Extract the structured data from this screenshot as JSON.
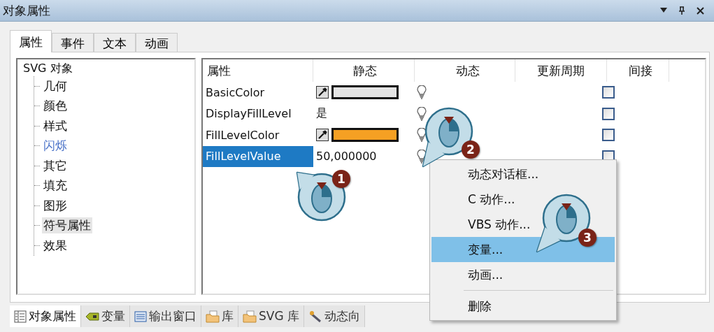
{
  "window": {
    "title": "对象属性"
  },
  "tabs": [
    {
      "label": "属性",
      "selected": true
    },
    {
      "label": "事件",
      "selected": false
    },
    {
      "label": "文本",
      "selected": false
    },
    {
      "label": "动画",
      "selected": false
    }
  ],
  "tree": {
    "label": "SVG 对象",
    "children": [
      {
        "label": "几何",
        "selected": false,
        "dynamic": false
      },
      {
        "label": "颜色",
        "selected": false,
        "dynamic": false
      },
      {
        "label": "样式",
        "selected": false,
        "dynamic": false
      },
      {
        "label": "闪烁",
        "selected": false,
        "dynamic": true
      },
      {
        "label": "其它",
        "selected": false,
        "dynamic": false
      },
      {
        "label": "填充",
        "selected": false,
        "dynamic": false
      },
      {
        "label": "图形",
        "selected": false,
        "dynamic": false
      },
      {
        "label": "符号属性",
        "selected": true,
        "dynamic": false
      },
      {
        "label": "效果",
        "selected": false,
        "dynamic": false
      }
    ]
  },
  "table": {
    "columns": [
      "属性",
      "静态",
      "动态",
      "更新周期",
      "间接"
    ],
    "rows": [
      {
        "name": "BasicColor",
        "kind": "color",
        "color": "#e4e4e4",
        "selected": false,
        "indirect": false
      },
      {
        "name": "DisplayFillLevel",
        "kind": "text",
        "value": "是",
        "selected": false,
        "indirect": false
      },
      {
        "name": "FillLevelColor",
        "kind": "color",
        "color": "#f5a023",
        "selected": false,
        "indirect": false
      },
      {
        "name": "FillLevelValue",
        "kind": "text",
        "value": "50,000000",
        "selected": true,
        "indirect": false
      }
    ]
  },
  "context_menu": [
    {
      "kind": "item",
      "label": "动态对话框...",
      "selected": false
    },
    {
      "kind": "item",
      "label": "C 动作...",
      "selected": false
    },
    {
      "kind": "item",
      "label": "VBS 动作...",
      "selected": false
    },
    {
      "kind": "item",
      "label": "变量...",
      "selected": true
    },
    {
      "kind": "item",
      "label": "动画...",
      "selected": false
    },
    {
      "kind": "separator"
    },
    {
      "kind": "item",
      "label": "删除",
      "selected": false
    }
  ],
  "callouts": [
    "1",
    "2",
    "3"
  ],
  "bottom_tabs": [
    {
      "label": "对象属性",
      "selected": true
    },
    {
      "label": "变量",
      "selected": false
    },
    {
      "label": "输出窗口",
      "selected": false
    },
    {
      "label": "库",
      "selected": false
    },
    {
      "label": "SVG 库",
      "selected": false
    },
    {
      "label": "动态向",
      "selected": false
    }
  ]
}
